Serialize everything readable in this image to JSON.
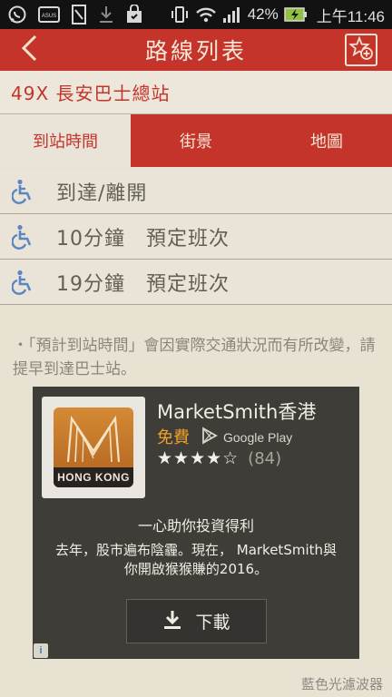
{
  "status_bar": {
    "battery_percent": "42%",
    "time": "上午11:46"
  },
  "header": {
    "title": "路線列表"
  },
  "route": {
    "name": "49X 長安巴士總站"
  },
  "tabs": [
    {
      "label": "到站時間",
      "active": true
    },
    {
      "label": "街景",
      "active": false
    },
    {
      "label": "地圖",
      "active": false
    }
  ],
  "arrivals": [
    {
      "text": "到達/離開"
    },
    {
      "text": "10分鐘　預定班次"
    },
    {
      "text": "19分鐘　預定班次"
    }
  ],
  "note": "・「預計到站時間」會因實際交通狀況而有所改變，請提早到達巴士站。",
  "ad": {
    "logo_text": "HONG KONG",
    "app_name": "MarketSmith香港",
    "price": "免費",
    "store": "Google Play",
    "stars": "★★★★☆",
    "rating_count": "(84)",
    "tagline": "一心助你投資得利",
    "description_line1": "去年，股市遍布陰霾。現在， MarketSmith與",
    "description_line2": "你開啟猴猴賺的2016。",
    "download_label": "下載",
    "info_label": "i"
  },
  "watermark": "藍色光濾波器",
  "colors": {
    "brand_red": "#c4342a",
    "background": "#e8e2d3",
    "accessibility_blue": "#5b86c4",
    "ad_orange": "#f0a02b"
  },
  "icons": [
    "whatsapp-icon",
    "asus-icon",
    "document-icon",
    "download-icon",
    "bag-icon",
    "vibrate-icon",
    "wifi-icon",
    "signal-icon",
    "battery-charging-icon",
    "back-arrow-icon",
    "star-add-icon",
    "wheelchair-icon",
    "google-play-icon",
    "download-arrow-icon",
    "info-icon"
  ]
}
